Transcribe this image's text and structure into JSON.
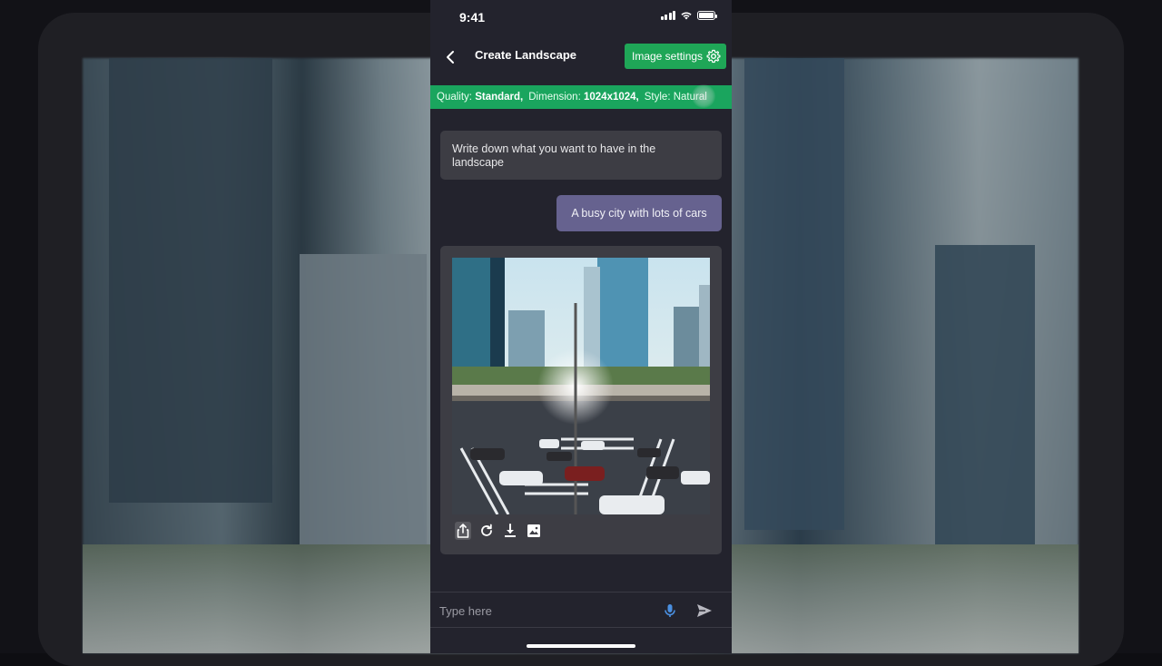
{
  "status": {
    "time": "9:41"
  },
  "header": {
    "title": "Create Landscape",
    "settings_label": "Image settings"
  },
  "info": {
    "quality_label": "Quality:",
    "quality_value": "Standard,",
    "dimension_label": "Dimension:",
    "dimension_value": "1024x1024,",
    "style_label": "Style:",
    "style_value": "Natural"
  },
  "chat": {
    "assistant_prompt": "Write down what you want to have in the landscape",
    "user_message": "A busy city with lots of cars"
  },
  "image_actions": [
    "share-icon",
    "refresh-icon",
    "download-icon",
    "image-icon"
  ],
  "input": {
    "placeholder": "Type here"
  },
  "colors": {
    "accent": "#1fa657",
    "user_bubble": "#66628f",
    "bubble": "#3d3d44",
    "background": "#23232d"
  }
}
